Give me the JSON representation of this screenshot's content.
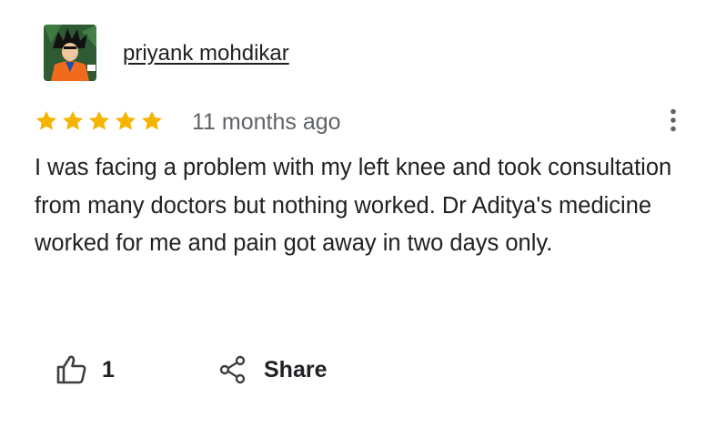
{
  "review": {
    "reviewer_name": "priyank mohdikar",
    "rating": 5,
    "max_rating": 5,
    "star_color": "#f4b400",
    "time_ago": "11 months ago",
    "text": "I was facing a problem with my left knee and took consultation from many doctors but nothing worked. Dr Aditya's medicine worked for me and pain got away in two days only.",
    "more_options_icon": "more-vert-icon"
  },
  "actions": {
    "like_icon": "thumbs-up-icon",
    "like_count": "1",
    "share_icon": "share-icon",
    "share_label": "Share"
  }
}
